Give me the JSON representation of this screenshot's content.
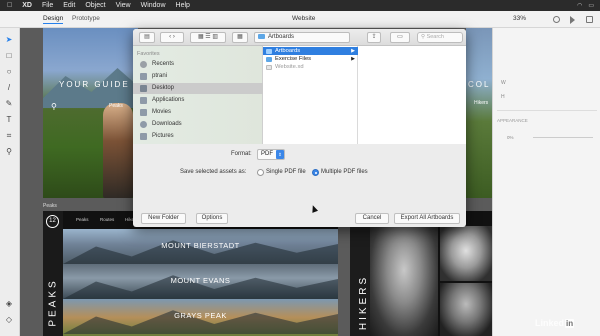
{
  "menubar": {
    "app": "XD",
    "items": [
      "File",
      "Edit",
      "Object",
      "View",
      "Window",
      "Help"
    ]
  },
  "xd": {
    "tabs": [
      "Design",
      "Prototype"
    ],
    "doc_title": "Website",
    "zoom": "33%"
  },
  "canvas": {
    "hero_left_text": "YOUR GUIDE",
    "hero_right_text": "COL",
    "peaks_caption": "Peaks",
    "hikers_caption": "Hikers",
    "artboard_label_peaks": "Peaks",
    "peaks_nav": [
      "Peaks",
      "Routes",
      "Hikers",
      "Gear",
      "Blog"
    ],
    "peaks_logo": "12",
    "peaks_vertical": "PEAKS",
    "peaks_bands": [
      "MOUNT BIERSTADT",
      "MOUNT EVANS",
      "GRAYS PEAK"
    ],
    "hikers_vertical": "HIKERS"
  },
  "right_panel": {
    "appearance_label": "APPEARANCE",
    "opacity_value": "0%",
    "w_label": "W",
    "h_label": "H"
  },
  "dialog": {
    "location": "Artboards",
    "search_placeholder": "Search",
    "favorites_label": "Favorites",
    "sidebar": [
      {
        "label": "Recents",
        "icon": "clock-icon",
        "color": "#9aa0a6"
      },
      {
        "label": "ptrani",
        "icon": "home-icon",
        "color": "#8e9aa8"
      },
      {
        "label": "Desktop",
        "icon": "desktop-icon",
        "color": "#8e9aa8",
        "selected": true
      },
      {
        "label": "Applications",
        "icon": "applications-icon",
        "color": "#8e9aa8"
      },
      {
        "label": "Movies",
        "icon": "movies-icon",
        "color": "#8e9aa8"
      },
      {
        "label": "Downloads",
        "icon": "downloads-icon",
        "color": "#8e9aa8"
      },
      {
        "label": "Pictures",
        "icon": "pictures-icon",
        "color": "#8e9aa8"
      }
    ],
    "files": [
      {
        "label": "Artboards",
        "selected": true
      },
      {
        "label": "Exercise Files"
      },
      {
        "label": "Website.xd",
        "dim": true
      }
    ],
    "format_label": "Format:",
    "format_value": "PDF",
    "save_label": "Save selected assets as:",
    "radio_single": "Single PDF file",
    "radio_multiple": "Multiple PDF files",
    "new_folder": "New Folder",
    "options": "Options",
    "cancel": "Cancel",
    "export": "Export All Artboards"
  },
  "watermark": {
    "text": "Linked",
    "in": "in"
  },
  "colors": {
    "accent": "#2f7fe0",
    "selection_gray": "#cbcbcb"
  }
}
